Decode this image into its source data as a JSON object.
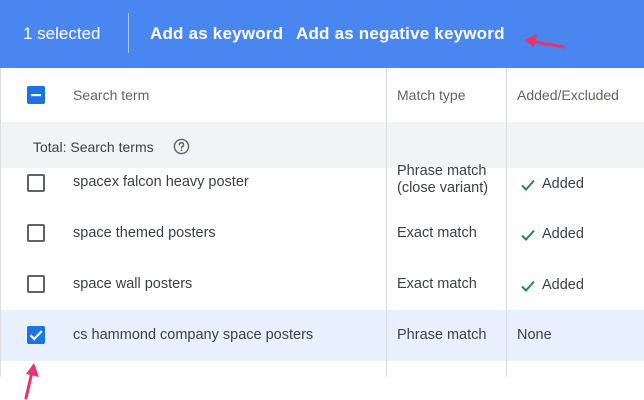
{
  "action_bar": {
    "selected_text": "1 selected",
    "add_keyword_label": "Add as keyword",
    "add_negative_label": "Add as negative keyword",
    "color": "#4a86f0"
  },
  "table": {
    "columns": {
      "search_term": "Search term",
      "match_type": "Match type",
      "added_excluded": "Added/Excluded"
    },
    "total_label": "Total: Search terms",
    "rows": [
      {
        "term": "spacex falcon heavy poster",
        "match_type": "Phrase match (close variant)",
        "status": "Added",
        "checked": false
      },
      {
        "term": "space themed posters",
        "match_type": "Exact match",
        "status": "Added",
        "checked": false
      },
      {
        "term": "space wall posters",
        "match_type": "Exact match",
        "status": "Added",
        "checked": false
      },
      {
        "term": "cs hammond company space posters",
        "match_type": "Phrase match",
        "status": "None",
        "checked": true
      }
    ]
  },
  "icons": {
    "header_checkbox": "indeterminate-checkbox-icon",
    "help": "help-circle-icon",
    "added": "checkmark-icon",
    "annotation": "pink-arrow-icon"
  },
  "colors": {
    "checkbox_blue": "#1a73e8",
    "added_check_green": "#1e8e3e",
    "selected_row": "#e8f0fe",
    "annotation_pink": "#e8336d"
  }
}
